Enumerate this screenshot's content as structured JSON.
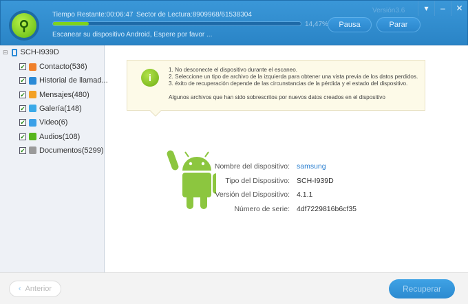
{
  "header": {
    "time_remaining": "Tiempo Restante:00:06:47",
    "sector": "Sector de Lectura:8909968/61538304",
    "progress_percent": 14.47,
    "progress_label": "14,47%",
    "status": "Escanear su dispositivo Android, Espere por favor ...",
    "version": "Versión3.6",
    "pause_label": "Pausa",
    "stop_label": "Parar"
  },
  "sidebar": {
    "device": "SCH-I939D",
    "items": [
      {
        "label": "Contacto(536)",
        "color": "#f0802a"
      },
      {
        "label": "Historial de llamad...",
        "color": "#2a8ad6"
      },
      {
        "label": "Mensajes(480)",
        "color": "#f3a125"
      },
      {
        "label": "Galería(148)",
        "color": "#3aa9e8"
      },
      {
        "label": "Video(6)",
        "color": "#3aa0e8"
      },
      {
        "label": "Audios(108)",
        "color": "#56b51c"
      },
      {
        "label": "Documentos(5299)",
        "color": "#9a9a9a"
      }
    ]
  },
  "notice": {
    "line1": "1. No desconecte el dispositivo durante el escaneo.",
    "line2": "2. Seleccione un tipo de archivo de la izquierda para obtener una vista previa de los datos perdidos.",
    "line3": "3. éxito de recuperación depende de las circunstancias de la pérdida y el estado del dispositivo.",
    "line4": "Algunos archivos que han sido sobrescritos por nuevos datos creados en el dispositivo"
  },
  "device": [
    {
      "key": "Nombre del dispositivo:",
      "value": "samsung",
      "color": "#2a7fd0"
    },
    {
      "key": "Tipo del Dispositivo:",
      "value": "SCH-I939D"
    },
    {
      "key": "Versión del Dispositivo:",
      "value": "4.1.1"
    },
    {
      "key": "Número de serie:",
      "value": "4df7229816b6cf35"
    }
  ],
  "footer": {
    "prev_label": "Anterior",
    "recover_label": "Recuperar"
  }
}
